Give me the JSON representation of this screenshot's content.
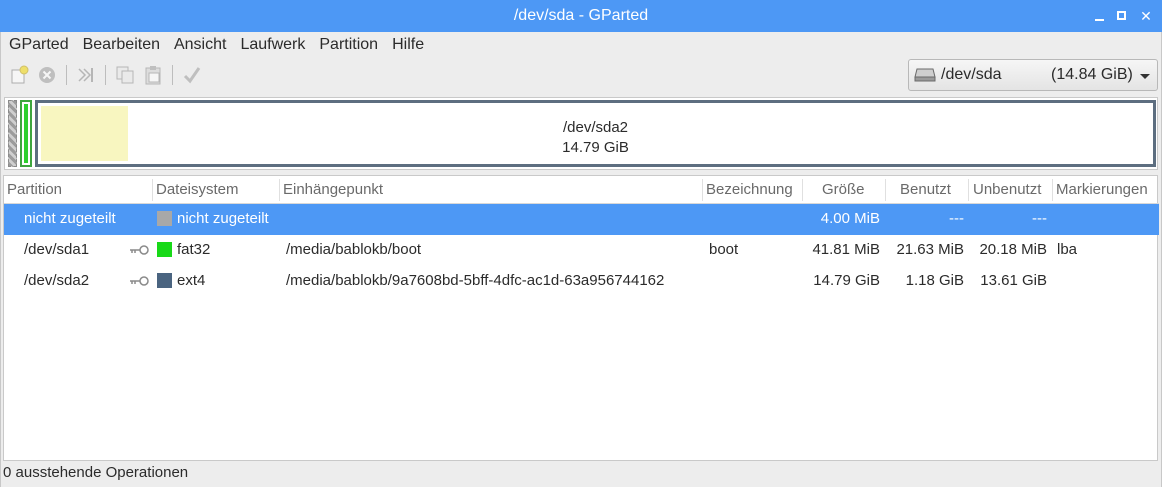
{
  "window": {
    "title": "/dev/sda - GParted"
  },
  "menu": [
    "GParted",
    "Bearbeiten",
    "Ansicht",
    "Laufwerk",
    "Partition",
    "Hilfe"
  ],
  "toolbar": {
    "icons": [
      "new-partition-icon",
      "delete-icon",
      "resize-move-icon",
      "copy-icon",
      "paste-icon",
      "apply-icon"
    ]
  },
  "device": {
    "name": "/dev/sda",
    "size": "(14.84 GiB)"
  },
  "diskmap": {
    "label": "/dev/sda2",
    "size": "14.79 GiB"
  },
  "columns": [
    "Partition",
    "Dateisystem",
    "Einhängepunkt",
    "Bezeichnung",
    "Größe",
    "Benutzt",
    "Unbenutzt",
    "Markierungen"
  ],
  "rows": [
    {
      "partition": "nicht zugeteilt",
      "fs": "nicht zugeteilt",
      "fs_color": "#a8a8a8",
      "mount": "",
      "label": "",
      "size": "4.00 MiB",
      "used": "---",
      "unused": "---",
      "flags": "",
      "key": false,
      "selected": true
    },
    {
      "partition": "/dev/sda1",
      "fs": "fat32",
      "fs_color": "#18d918",
      "mount": "/media/bablokb/boot",
      "label": "boot",
      "size": "41.81 MiB",
      "used": "21.63 MiB",
      "unused": "20.18 MiB",
      "flags": "lba",
      "key": true,
      "selected": false
    },
    {
      "partition": "/dev/sda2",
      "fs": "ext4",
      "fs_color": "#4a6480",
      "mount": "/media/bablokb/9a7608bd-5bff-4dfc-ac1d-63a956744162",
      "label": "",
      "size": "14.79 GiB",
      "used": "1.18 GiB",
      "unused": "13.61 GiB",
      "flags": "",
      "key": true,
      "selected": false
    }
  ],
  "status": "0 ausstehende Operationen"
}
